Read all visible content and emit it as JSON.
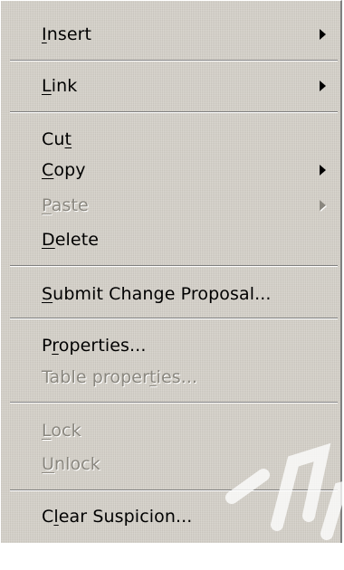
{
  "menu": {
    "items": [
      {
        "pre": "",
        "mn": "I",
        "post": "nsert",
        "disabled": false,
        "submenu": true
      },
      {
        "pre": "",
        "mn": "L",
        "post": "ink",
        "disabled": false,
        "submenu": true
      },
      {
        "pre": "Cu",
        "mn": "t",
        "post": "",
        "disabled": false,
        "submenu": false
      },
      {
        "pre": "",
        "mn": "C",
        "post": "opy",
        "disabled": false,
        "submenu": true
      },
      {
        "pre": "",
        "mn": "P",
        "post": "aste",
        "disabled": true,
        "submenu": true
      },
      {
        "pre": "",
        "mn": "D",
        "post": "elete",
        "disabled": false,
        "submenu": false
      },
      {
        "pre": "",
        "mn": "S",
        "post": "ubmit Change Proposal...",
        "disabled": false,
        "submenu": false
      },
      {
        "pre": "P",
        "mn": "r",
        "post": "operties...",
        "disabled": false,
        "submenu": false
      },
      {
        "pre": "Table proper",
        "mn": "t",
        "post": "ies...",
        "disabled": true,
        "submenu": false
      },
      {
        "pre": "",
        "mn": "L",
        "post": "ock",
        "disabled": true,
        "submenu": false
      },
      {
        "pre": "",
        "mn": "U",
        "post": "nlock",
        "disabled": true,
        "submenu": false
      },
      {
        "pre": "C",
        "mn": "l",
        "post": "ear Suspicion...",
        "disabled": false,
        "submenu": false
      }
    ]
  },
  "icons": {
    "submenu_arrow": "triangle-right-icon",
    "watermark": "watermark-overlay"
  },
  "colors": {
    "menu_background": "#d4d0c8",
    "disabled_text": "#8a877f",
    "separator_dark": "#808080",
    "separator_light": "#ffffff"
  }
}
